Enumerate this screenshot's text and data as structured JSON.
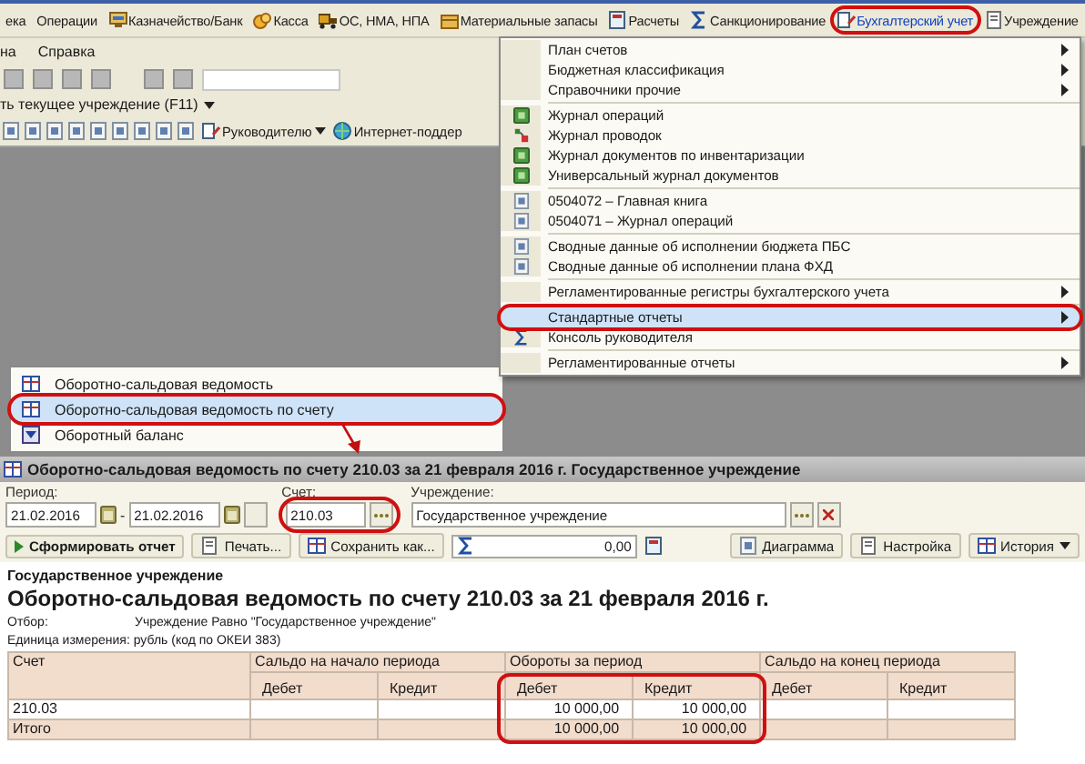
{
  "menubar": {
    "items": [
      {
        "label": "ека",
        "selected": false,
        "highlighted": false
      },
      {
        "label": "Операции",
        "selected": false,
        "highlighted": false
      },
      {
        "label": "Казначейство/Банк",
        "selected": false,
        "highlighted": false
      },
      {
        "label": "Касса",
        "selected": false,
        "highlighted": false
      },
      {
        "label": "ОС, НМА, НПА",
        "selected": false,
        "highlighted": false
      },
      {
        "label": "Материальные запасы",
        "selected": false,
        "highlighted": false
      },
      {
        "label": "Расчеты",
        "selected": false,
        "highlighted": false
      },
      {
        "label": "Санкционирование",
        "selected": false,
        "highlighted": false
      },
      {
        "label": "Бухгалтерский учет",
        "selected": true,
        "highlighted": true
      },
      {
        "label": "Учреждение",
        "selected": false,
        "highlighted": false
      }
    ]
  },
  "menubar2": {
    "items": [
      "на",
      "Справка"
    ]
  },
  "org_selector": {
    "label": "ть текущее учреждение (F11)"
  },
  "quick_panel": {
    "items": [
      {
        "label": "Руководителю",
        "dropdown": true
      },
      {
        "label": "Интернет-поддер",
        "dropdown": false
      }
    ]
  },
  "menu": {
    "groups": [
      [
        {
          "label": "План счетов",
          "submenu": true,
          "selected": false,
          "highlighted": false
        },
        {
          "label": "Бюджетная классификация",
          "submenu": true,
          "selected": false,
          "highlighted": false
        },
        {
          "label": "Справочники прочие",
          "submenu": true,
          "selected": false,
          "highlighted": false
        }
      ],
      [
        {
          "label": "Журнал операций",
          "submenu": false,
          "selected": false,
          "highlighted": false
        },
        {
          "label": "Журнал проводок",
          "submenu": false,
          "selected": false,
          "highlighted": false
        },
        {
          "label": "Журнал документов по инвентаризации",
          "submenu": false,
          "selected": false,
          "highlighted": false
        },
        {
          "label": "Универсальный журнал документов",
          "submenu": false,
          "selected": false,
          "highlighted": false
        }
      ],
      [
        {
          "label": "0504072  –  Главная книга",
          "submenu": false,
          "selected": false,
          "highlighted": false
        },
        {
          "label": "0504071  –  Журнал операций",
          "submenu": false,
          "selected": false,
          "highlighted": false
        }
      ],
      [
        {
          "label": "Сводные данные об исполнении бюджета ПБС",
          "submenu": false,
          "selected": false,
          "highlighted": false
        },
        {
          "label": "Сводные данные об исполнении плана ФХД",
          "submenu": false,
          "selected": false,
          "highlighted": false
        }
      ],
      [
        {
          "label": "Регламентированные регистры бухгалтерского учета",
          "submenu": true,
          "selected": false,
          "highlighted": false
        }
      ],
      [
        {
          "label": "Стандартные отчеты",
          "submenu": true,
          "selected": true,
          "highlighted": true
        },
        {
          "label": "Консоль руководителя",
          "submenu": false,
          "selected": false,
          "highlighted": false
        }
      ],
      [
        {
          "label": "Регламентированные отчеты",
          "submenu": true,
          "selected": false,
          "highlighted": false
        }
      ]
    ]
  },
  "submenu": {
    "items": [
      {
        "label": "Оборотно-сальдовая ведомость",
        "selected": false,
        "highlighted": false
      },
      {
        "label": "Оборотно-сальдовая ведомость по счету",
        "selected": true,
        "highlighted": true
      },
      {
        "label": "Оборотный баланс",
        "selected": false,
        "highlighted": false
      }
    ]
  },
  "report_window": {
    "title": "Оборотно-сальдовая ведомость по счету 210.03 за 21 февраля 2016 г. Государственное учреждение",
    "period_label": "Период:",
    "period_from": "21.02.2016",
    "period_separator": "-",
    "period_to": "21.02.2016",
    "account_label": "Счет:",
    "account": "210.03",
    "account_highlighted": true,
    "org_label": "Учреждение:",
    "org": "Государственное учреждение",
    "toolbar": {
      "generate": "Сформировать отчет",
      "print": "Печать...",
      "save": "Сохранить как...",
      "sum_value": "0,00",
      "chart": "Диаграмма",
      "settings": "Настройка",
      "history": "История"
    },
    "report": {
      "org": "Государственное учреждение",
      "heading": "Оборотно-сальдовая ведомость по счету 210.03 за 21 февраля 2016 г.",
      "filter_label": "Отбор:",
      "filter_value": "Учреждение Равно \"Государственное учреждение\"",
      "unit": "Единица измерения: рубль (код по ОКЕИ 383)",
      "table": {
        "account_header": "Счет",
        "groups": [
          "Сальдо на начало периода",
          "Обороты за период",
          "Сальдо на конец периода"
        ],
        "subheaders": [
          "Дебет",
          "Кредит",
          "Дебет",
          "Кредит",
          "Дебет",
          "Кредит"
        ],
        "turnover_highlighted": true,
        "rows": [
          {
            "kind": "account",
            "cells": [
              "210.03",
              null,
              null,
              "10 000,00",
              "10 000,00",
              null,
              null
            ]
          },
          {
            "kind": "total",
            "cells": [
              "Итого",
              null,
              null,
              "10 000,00",
              "10 000,00",
              null,
              null
            ]
          }
        ]
      }
    }
  }
}
